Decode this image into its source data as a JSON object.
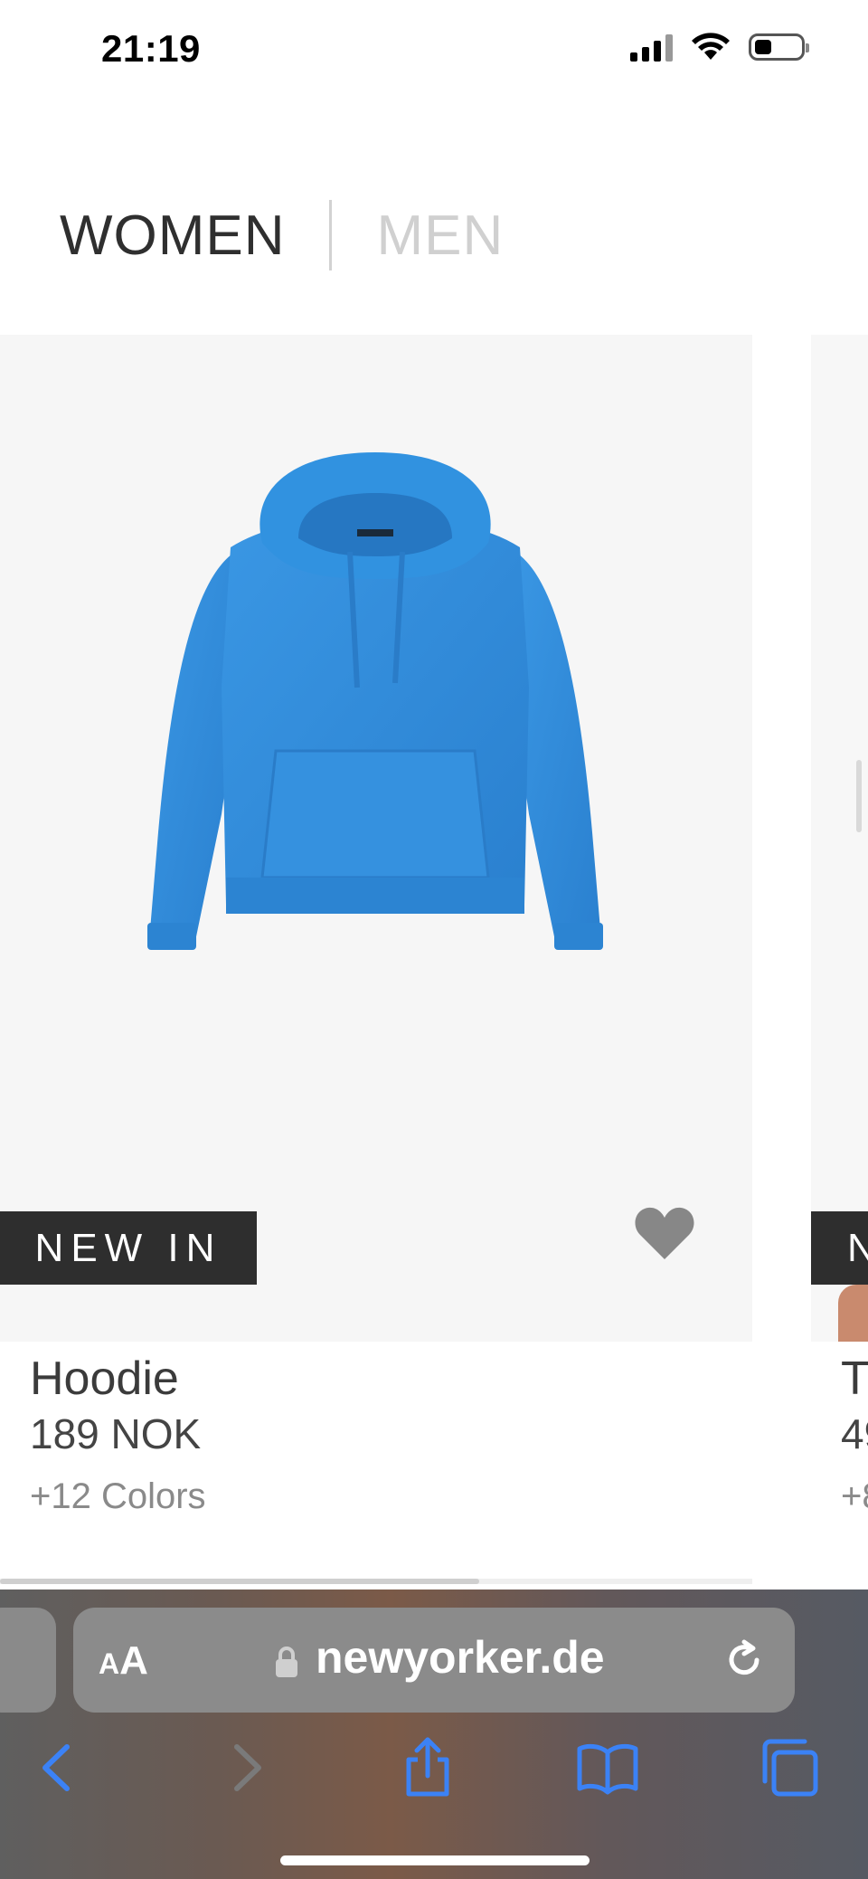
{
  "status_bar": {
    "time": "21:19"
  },
  "gender_tabs": {
    "women": "WOMEN",
    "men": "MEN"
  },
  "product": {
    "badge": "NEW IN",
    "name": "Hoodie",
    "price": "189 NOK",
    "colors": "+12 Colors",
    "color_hex": "#2f8ad8"
  },
  "product_next": {
    "badge": "N",
    "name": "T",
    "price": "49",
    "colors": "+8"
  },
  "browser": {
    "aa_label": "AA",
    "url": "newyorker.de"
  },
  "icons": {
    "favorite": "heart-icon",
    "back": "chevron-left-icon",
    "forward": "chevron-right-icon",
    "share": "share-icon",
    "bookmarks": "book-icon",
    "tabs": "tabs-icon",
    "reload": "reload-icon",
    "lock": "lock-icon"
  },
  "colors": {
    "accent_blue": "#3b82f6",
    "badge_bg": "#2e2e2e"
  }
}
